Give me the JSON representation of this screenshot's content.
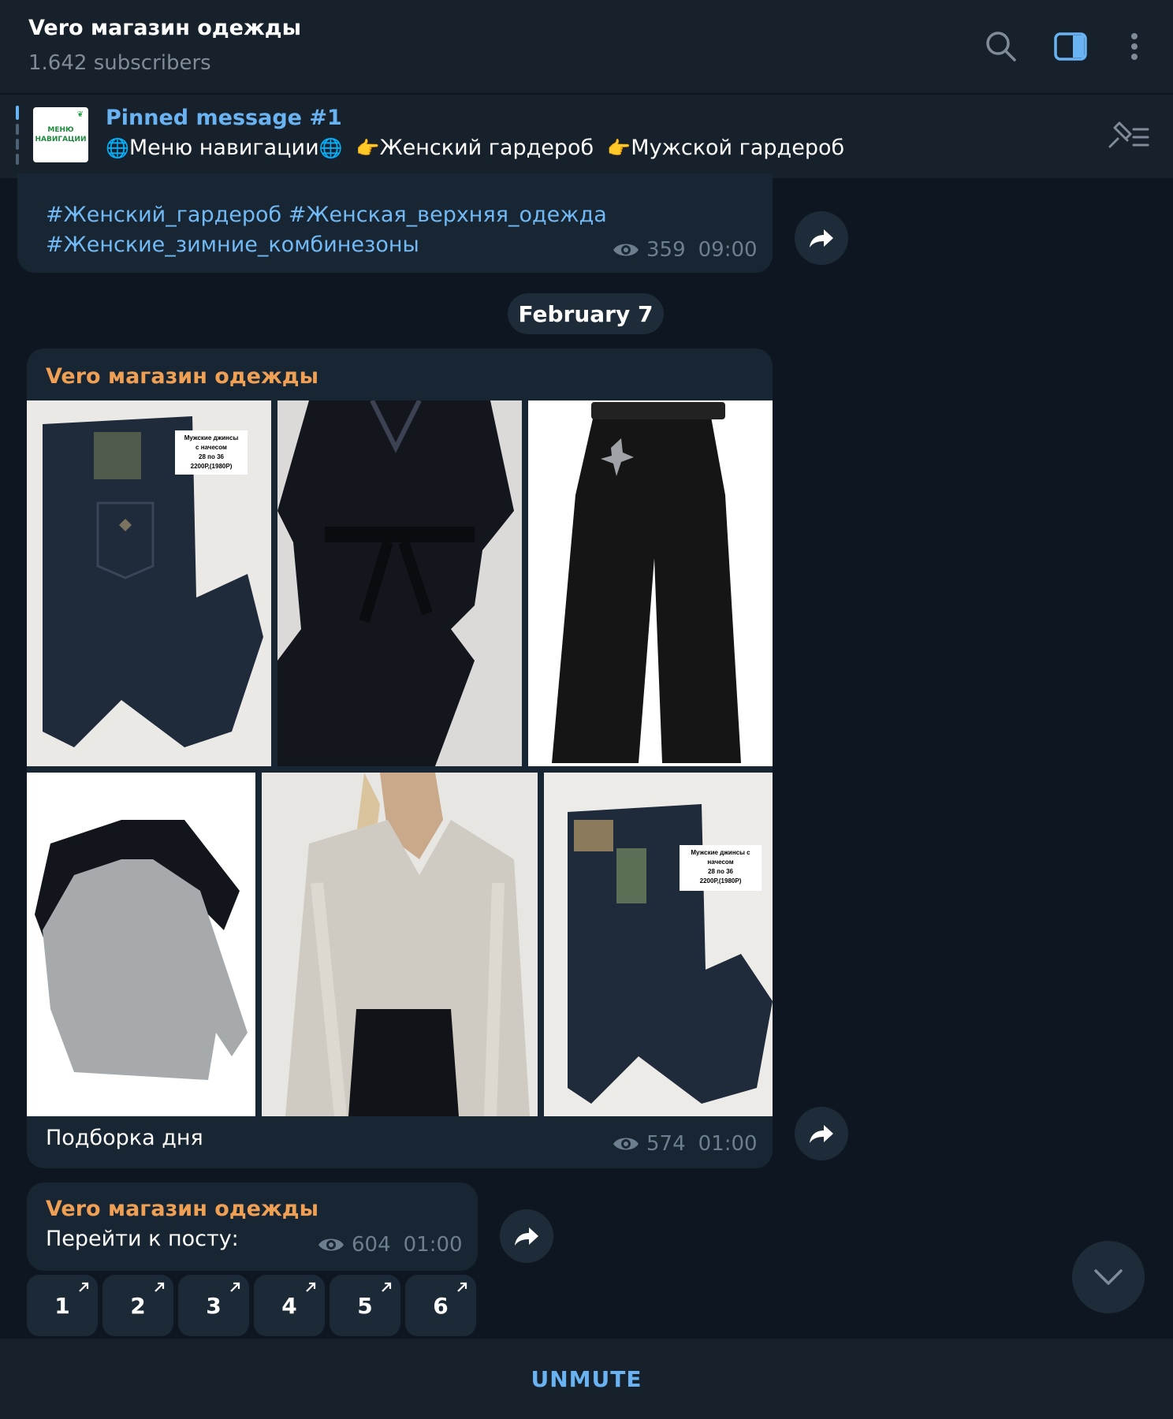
{
  "header": {
    "title": "Vero магазин одежды",
    "subtitle": "1.642 subscribers",
    "icons": [
      "search-icon",
      "sidebar-toggle-icon",
      "more-vertical-icon"
    ]
  },
  "pinned": {
    "title": "Pinned message #1",
    "thumb_text_line1": "МЕНЮ",
    "thumb_text_line2": "НАВИГАЦИИ",
    "globe1": "🌐",
    "menu_text": "Меню навигации",
    "globe2": "🌐",
    "point1": "👉",
    "women_text": "Женский гардероб",
    "point2": "👉",
    "men_text": "Мужской гардероб"
  },
  "message_top": {
    "hashtags_line1": "#Женский_гардероб #Женская_верхняя_одежда",
    "hashtags_line2": "#Женские_зимние_комбинезоны",
    "views": "359",
    "time": "09:00"
  },
  "date_separator": "February 7",
  "album": {
    "sender": "Vero магазин одежды",
    "photos": [
      {
        "name": "men-jeans-photo",
        "tag_lines": [
          "Мужские джинсы",
          "с начесом",
          "28 по 36",
          "2200Р,(1980Р)"
        ]
      },
      {
        "name": "black-blouse-photo"
      },
      {
        "name": "black-trousers-photo"
      },
      {
        "name": "sweaters-photo"
      },
      {
        "name": "sequin-shirt-photo"
      },
      {
        "name": "men-jeans-photo-2",
        "tag_lines": [
          "Мужские джинсы с",
          "начесом",
          "28 по 36",
          "2200Р,(1980Р)"
        ]
      }
    ],
    "caption": "Подборка дня",
    "views": "574",
    "time": "01:00"
  },
  "post_link": {
    "sender": "Vero магазин одежды",
    "text": "Перейти к посту:",
    "views": "604",
    "time": "01:00",
    "buttons": [
      "1",
      "2",
      "3",
      "4",
      "5",
      "6"
    ]
  },
  "bottom": {
    "unmute_label": "UNMUTE"
  },
  "colors": {
    "background": "#0e1621",
    "panel": "#17212b",
    "bubble": "#182533",
    "link": "#6ab3f3",
    "sender": "#f0a054",
    "meta": "#6d7f8f"
  }
}
